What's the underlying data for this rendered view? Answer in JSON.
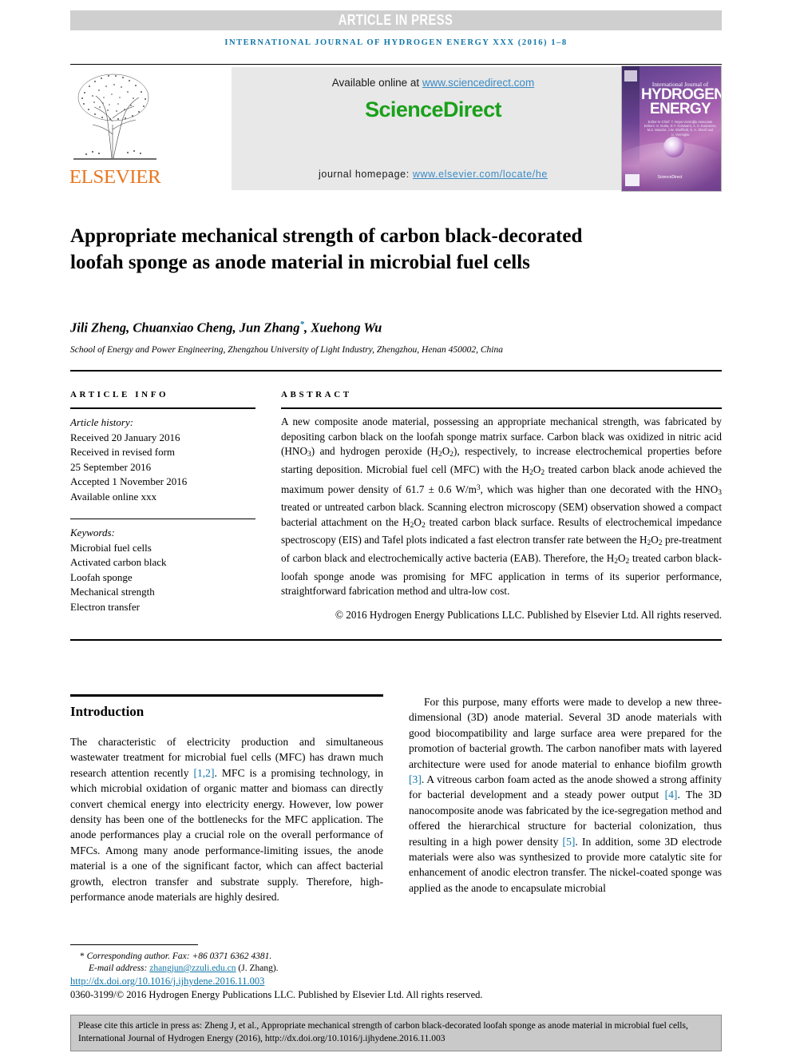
{
  "banner": {
    "label": "ARTICLE IN PRESS"
  },
  "running_head": {
    "journal_line": "INTERNATIONAL JOURNAL OF HYDROGEN ENERGY XXX (2016) 1–8"
  },
  "masthead": {
    "publisher_wordmark": "ELSEVIER",
    "available_prefix": "Available online at ",
    "available_url": "www.sciencedirect.com",
    "brand": "ScienceDirect",
    "homepage_label": "journal homepage: ",
    "homepage_url": "www.elsevier.com/locate/he",
    "cover": {
      "line_international": "International Journal of",
      "line_hydrogen": "HYDROGEN",
      "line_energy": "ENERGY",
      "editors": "Editor-in-Chief: T. Nejat Veziroğlu   Associate Editors: S. Dutta, D.Y. Goswami, A. A. Kusnezov, M.Z. Mandor, J.W. Sheffield, S. A. Sherif and U. Vermiglio",
      "science_direct": "ScienceDirect"
    }
  },
  "article": {
    "title": "Appropriate mechanical strength of carbon black-decorated loofah sponge as anode material in microbial fuel cells",
    "authors": "Jili Zheng, Chuanxiao Cheng, Jun Zhang",
    "authors_tail": ", Xuehong Wu",
    "corresponding_marker": "*",
    "affiliation": "School of Energy and Power Engineering, Zhengzhou University of Light Industry, Zhengzhou, Henan 450002, China"
  },
  "article_info": {
    "heading": "ARTICLE INFO",
    "history_label": "Article history:",
    "history": [
      "Received 20 January 2016",
      "Received in revised form",
      "25 September 2016",
      "Accepted 1 November 2016",
      "Available online xxx"
    ],
    "keywords_label": "Keywords:",
    "keywords": [
      "Microbial fuel cells",
      "Activated carbon black",
      "Loofah sponge",
      "Mechanical strength",
      "Electron transfer"
    ]
  },
  "abstract": {
    "heading": "ABSTRACT",
    "copyright": "© 2016 Hydrogen Energy Publications LLC. Published by Elsevier Ltd. All rights reserved."
  },
  "body": {
    "left": {
      "section_title": "Introduction",
      "references_inline": [
        "[1,2]"
      ]
    },
    "right": {
      "references_inline": [
        "[3]",
        "[4]",
        "[5]"
      ]
    }
  },
  "footnote": {
    "corresponding": "Corresponding author. Fax: +86 0371 6362 4381.",
    "email_label": "E-mail address: ",
    "email": "zhangjun@zzuli.edu.cn",
    "email_suffix": " (J. Zhang).",
    "doi": "http://dx.doi.org/10.1016/j.ijhydene.2016.11.003",
    "issn_line": "0360-3199/© 2016 Hydrogen Energy Publications LLC. Published by Elsevier Ltd. All rights reserved."
  },
  "cite_box": {
    "text": "Please cite this article in press as: Zheng J, et al., Appropriate mechanical strength of carbon black-decorated loofah sponge as anode material in microbial fuel cells, International Journal of Hydrogen Energy (2016), http://dx.doi.org/10.1016/j.ijhydene.2016.11.003"
  },
  "colors": {
    "link": "#1176a8",
    "brand_green": "#1aa01a",
    "elsevier_orange": "#e87722",
    "banner_gray": "#cfcfcf",
    "panel_gray": "#e8e8e8",
    "cite_gray": "#c9c9c9"
  }
}
